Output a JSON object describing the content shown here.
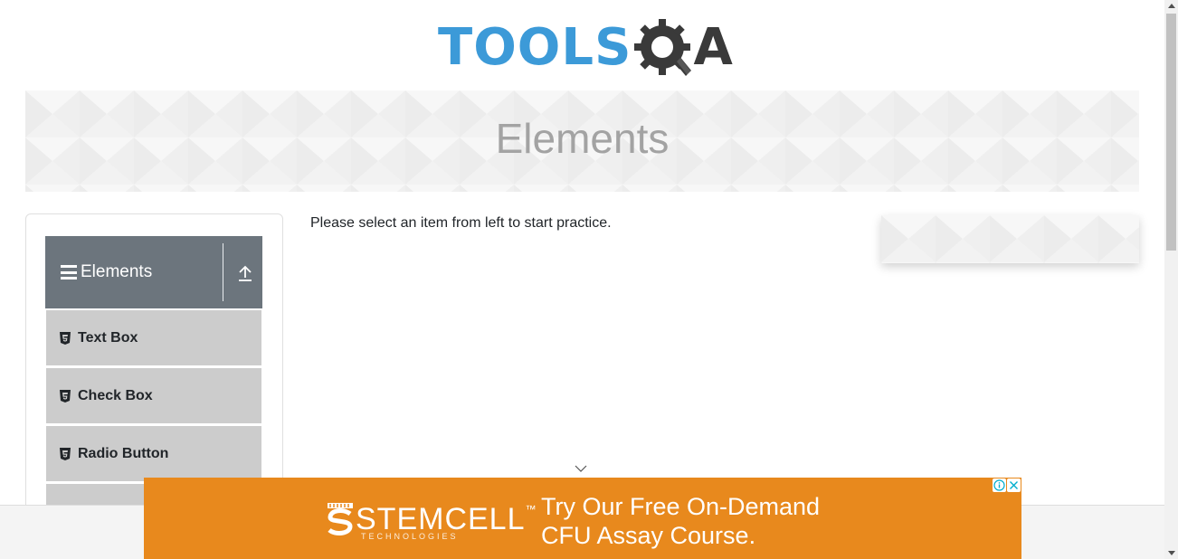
{
  "header": {
    "logo_text_primary": "TOOLS",
    "logo_text_secondary": "A",
    "logo_icon": "gear-magnifier-icon"
  },
  "banner": {
    "title": "Elements"
  },
  "sidebar": {
    "group_label": "Elements",
    "group_icon": "hamburger-icon",
    "collapse_icon": "upload-arrow-icon",
    "items": [
      {
        "label": "Text Box",
        "icon": "html5-icon"
      },
      {
        "label": "Check Box",
        "icon": "html5-icon"
      },
      {
        "label": "Radio Button",
        "icon": "html5-icon"
      },
      {
        "label": "",
        "icon": "html5-icon"
      }
    ]
  },
  "main": {
    "instruction": "Please select an item from left to start practice."
  },
  "bottom_ad": {
    "brand": "STEMCELL",
    "brand_tm": "™",
    "brand_sub": "TECHNOLOGIES",
    "line1": "Try Our Free On-Demand",
    "line2": "CFU Assay Course."
  },
  "colors": {
    "logo_blue": "#3c9ad8",
    "logo_dark": "#3a3a3a",
    "group_header_bg": "#6c757d",
    "menu_item_bg": "#cccccc",
    "ad_orange": "#e8891d",
    "banner_title": "#a3a3a3"
  }
}
